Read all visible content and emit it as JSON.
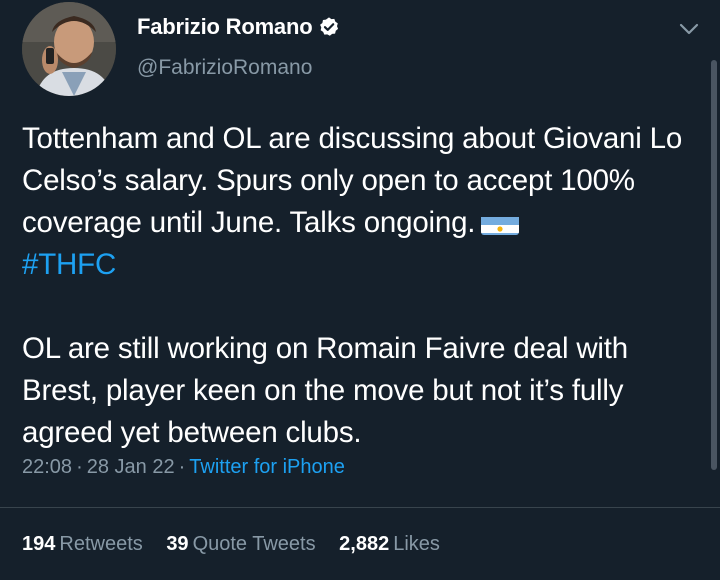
{
  "author": {
    "display_name": "Fabrizio Romano",
    "handle": "@FabrizioRomano",
    "verified": true
  },
  "tweet": {
    "paragraph1": "Tottenham and OL are discussing about Giovani Lo Celso’s salary. Spurs only open to accept 100% coverage until June. Talks ongoing.",
    "flag_icon": "argentina-flag-icon",
    "hashtag": "#THFC",
    "paragraph2": "OL are still working on Romain Faivre deal with Brest, player keen on the move but not it’s fully agreed yet between clubs."
  },
  "meta": {
    "time": "22:08",
    "date": "28 Jan 22",
    "separator": "·",
    "source": "Twitter for iPhone"
  },
  "stats": {
    "retweets_count": "194",
    "retweets_label": "Retweets",
    "quotes_count": "39",
    "quotes_label": "Quote Tweets",
    "likes_count": "2,882",
    "likes_label": "Likes"
  },
  "colors": {
    "background": "#15202b",
    "accent": "#1da1f2",
    "secondary_text": "#8899a6"
  }
}
